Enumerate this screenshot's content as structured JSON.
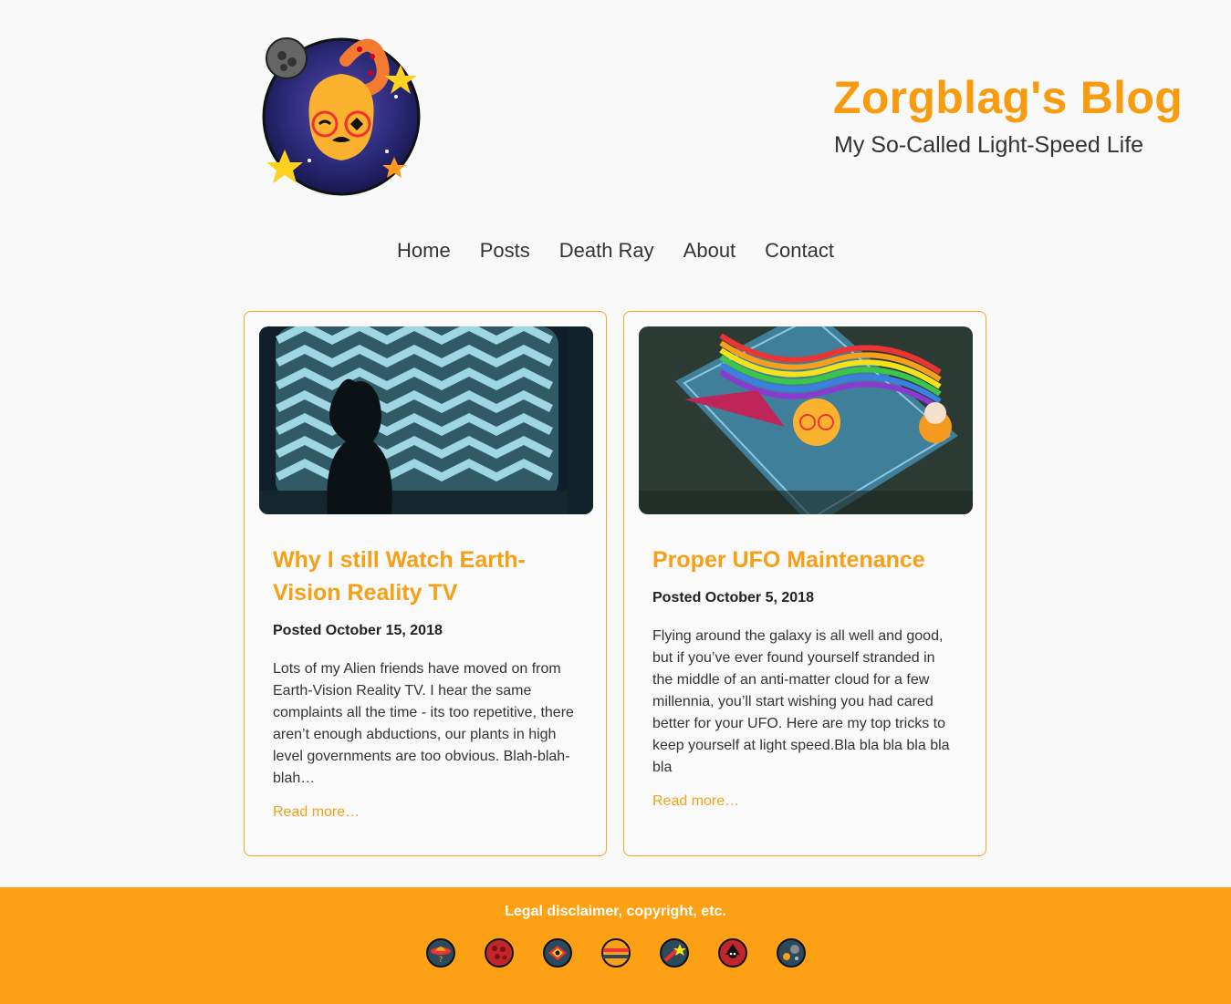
{
  "site": {
    "title": "Zorgblag's Blog",
    "subtitle": "My So-Called Light-Speed Life",
    "logo_icon": "alien-avatar-logo",
    "accent_color": "#f89b0e",
    "footer_color": "#fda014"
  },
  "nav": [
    {
      "label": "Home"
    },
    {
      "label": "Posts"
    },
    {
      "label": "Death Ray"
    },
    {
      "label": "About"
    },
    {
      "label": "Contact"
    }
  ],
  "posts": [
    {
      "title": "Why I still Watch Earth-Vision Reality TV",
      "date": "Posted October 15, 2018",
      "excerpt": "Lots of my Alien friends have moved on from Earth-Vision Reality TV. I hear the same complaints all the time - its too repetitive, there aren’t enough abductions, our plants in high level governments are too obvious. Blah-blah-blah…",
      "read_more": "Read more…",
      "image_icon": "tv-silhouette-image"
    },
    {
      "title": "Proper UFO Maintenance",
      "date": "Posted October 5, 2018",
      "excerpt": "Flying around the galaxy is all well and good, but if you’ve ever found yourself stranded in the middle of an anti-matter cloud for a few millennia, you’ll start wishing you had cared better for your UFO. Here are my top tricks to keep yourself at light speed.Bla bla bla bla bla bla",
      "read_more": "Read more…",
      "image_icon": "ufo-maintenance-image"
    }
  ],
  "footer": {
    "legal": "Legal disclaimer, copyright, etc.",
    "social_icons": [
      "ufo-icon",
      "red-planet-icon",
      "eye-planet-icon",
      "striped-planet-icon",
      "comet-icon",
      "skull-planet-icon",
      "asteroid-icon"
    ]
  }
}
